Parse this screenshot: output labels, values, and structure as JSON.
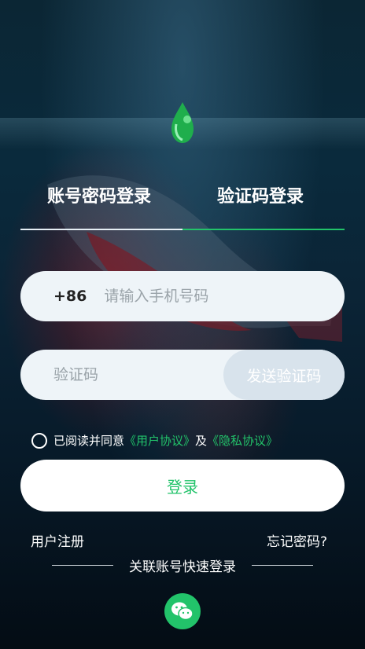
{
  "tabs": {
    "account_login": "账号密码登录",
    "code_login": "验证码登录"
  },
  "phone": {
    "prefix": "+86",
    "placeholder": "请输入手机号码"
  },
  "code": {
    "placeholder": "验证码",
    "send_label": "发送验证码"
  },
  "agreement": {
    "prefix": "已阅读并同意",
    "user_agreement": "《用户协议》",
    "and": "及",
    "privacy": "《隐私协议》"
  },
  "login_label": "登录",
  "register_label": "用户注册",
  "forgot_label": "忘记密码?",
  "quick_login_label": "关联账号快速登录",
  "colors": {
    "accent": "#22c36a",
    "field_bg": "#eef4f8"
  },
  "icons": {
    "logo": "water-drop-logo",
    "wechat": "wechat-icon"
  }
}
